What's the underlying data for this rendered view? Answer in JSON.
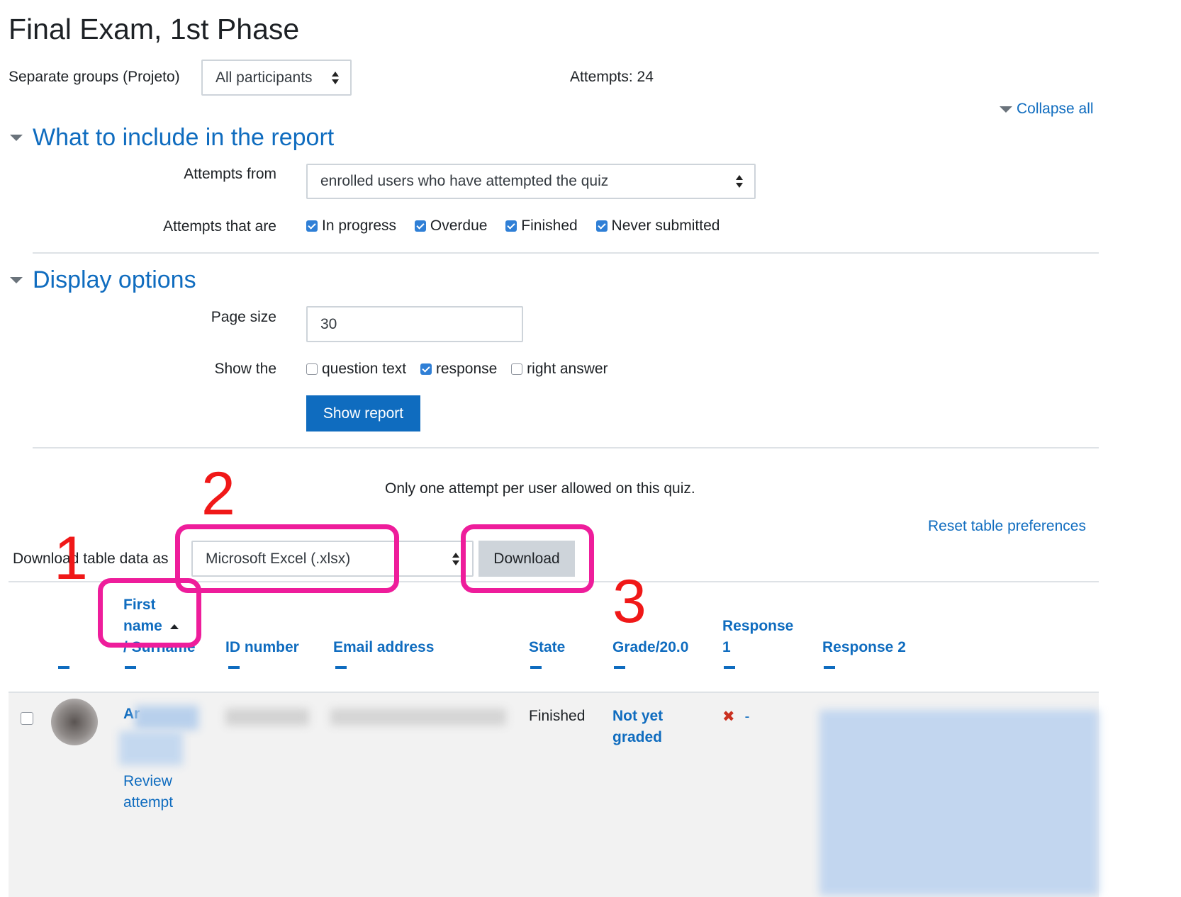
{
  "page": {
    "title": "Final Exam, 1st Phase",
    "group_label": "Separate groups (Projeto)",
    "group_select_value": "All participants",
    "attempts_summary": "Attempts: 24",
    "collapse_all": "Collapse all"
  },
  "report_section": {
    "heading": "What to include in the report",
    "attempts_from_label": "Attempts from",
    "attempts_from_value": "enrolled users who have attempted the quiz",
    "attempts_that_are_label": "Attempts that are",
    "states": [
      {
        "label": "In progress",
        "checked": true
      },
      {
        "label": "Overdue",
        "checked": true
      },
      {
        "label": "Finished",
        "checked": true
      },
      {
        "label": "Never submitted",
        "checked": true
      }
    ]
  },
  "display_section": {
    "heading": "Display options",
    "page_size_label": "Page size",
    "page_size_value": "30",
    "show_the_label": "Show the",
    "show_options": [
      {
        "label": "question text",
        "checked": false
      },
      {
        "label": "response",
        "checked": true
      },
      {
        "label": "right answer",
        "checked": false
      }
    ],
    "show_report_button": "Show report"
  },
  "notice": "Only one attempt per user allowed on this quiz.",
  "reset_prefs": "Reset table preferences",
  "download": {
    "label": "Download table data as",
    "format_value": "Microsoft Excel (.xlsx)",
    "button": "Download"
  },
  "annotations": [
    "1",
    "2",
    "3"
  ],
  "table": {
    "headers": {
      "first_name_line1": "First",
      "first_name_line2": "name",
      "surname": "/ Surname",
      "id_number": "ID number",
      "email": "Email address",
      "state": "State",
      "grade": "Grade/20.0",
      "response1_line1": "Response",
      "response1_line2": "1",
      "response2": "Response 2"
    },
    "row": {
      "name_initial": "Ar",
      "review_line1": "Review",
      "review_line2": "attempt",
      "state": "Finished",
      "grade_line1": "Not yet",
      "grade_line2": "graded",
      "response1_mark": "✖",
      "response1_dash": "-"
    }
  },
  "colors": {
    "link": "#0f6cbf",
    "annotation_box": "#ee1d9b",
    "annotation_number": "#f01818"
  }
}
